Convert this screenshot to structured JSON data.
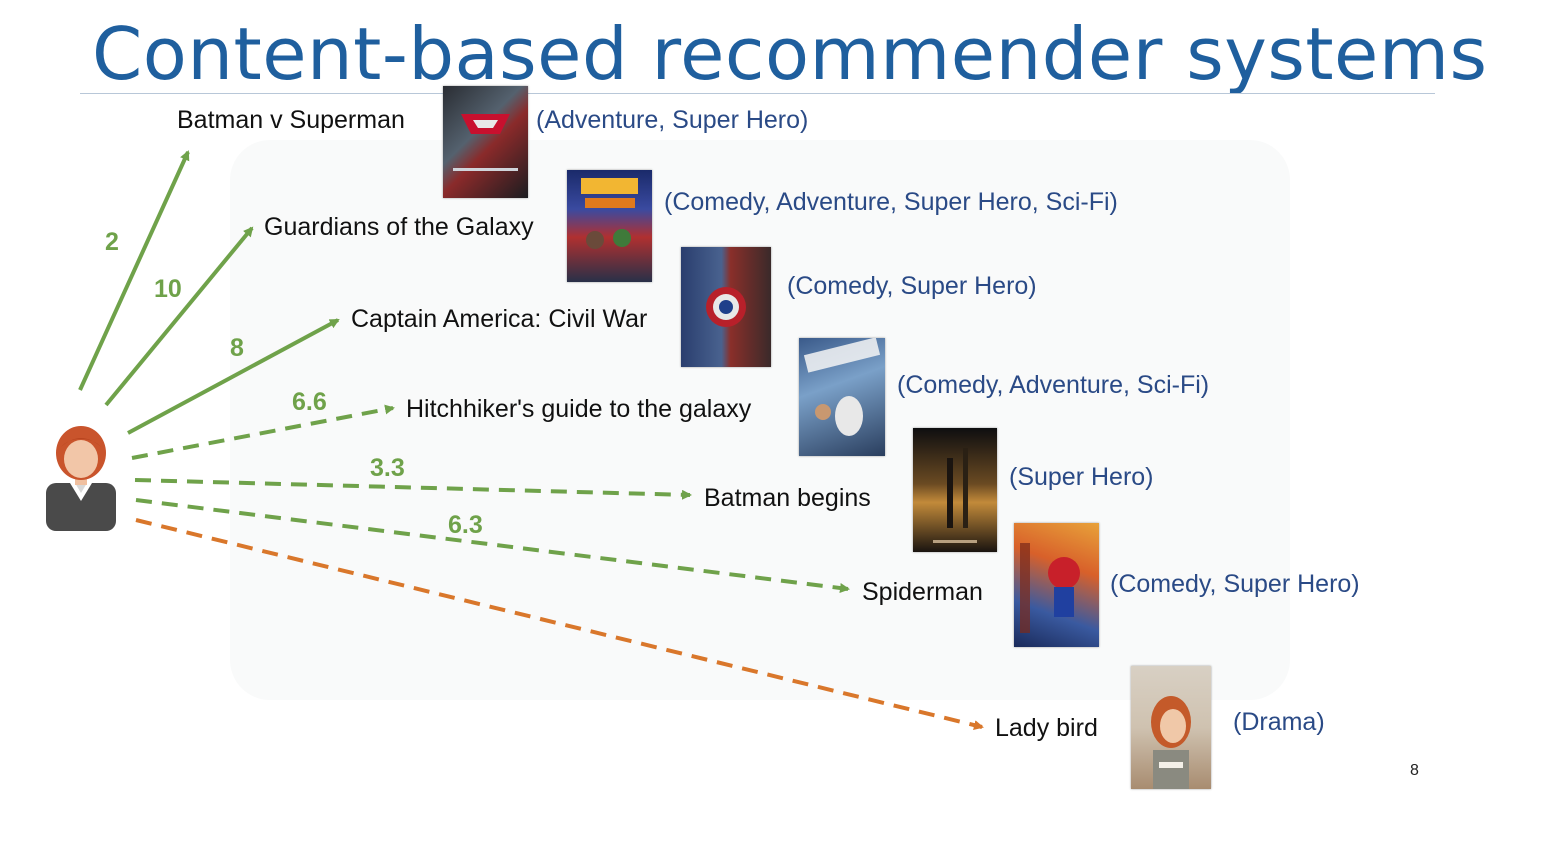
{
  "title": "Content-based recommender systems",
  "page_number": "8",
  "colors": {
    "title": "#1f5f9e",
    "genre_text": "#2a4a86",
    "rated_arrow": "#6fa24a",
    "unrated_arrow": "#d9772b"
  },
  "user_icon": "user-avatar-icon",
  "movies": [
    {
      "name": "Batman v Superman",
      "genres": "(Adventure, Super Hero)",
      "rating": "2",
      "status": "rated"
    },
    {
      "name": "Guardians of the Galaxy",
      "genres": "(Comedy, Adventure, Super Hero, Sci-Fi)",
      "rating": "10",
      "status": "rated"
    },
    {
      "name": "Captain America: Civil War",
      "genres": "(Comedy, Super Hero)",
      "rating": "8",
      "status": "rated"
    },
    {
      "name": "Hitchhiker's guide to the galaxy",
      "genres": "(Comedy, Adventure, Sci-Fi)",
      "rating": "6.6",
      "status": "predicted"
    },
    {
      "name": "Batman begins",
      "genres": "(Super Hero)",
      "rating": "3.3",
      "status": "predicted"
    },
    {
      "name": "Spiderman",
      "genres": "(Comedy, Super Hero)",
      "rating": "6.3",
      "status": "predicted"
    },
    {
      "name": "Lady bird",
      "genres": "(Drama)",
      "rating": "",
      "status": "unrelated"
    }
  ]
}
